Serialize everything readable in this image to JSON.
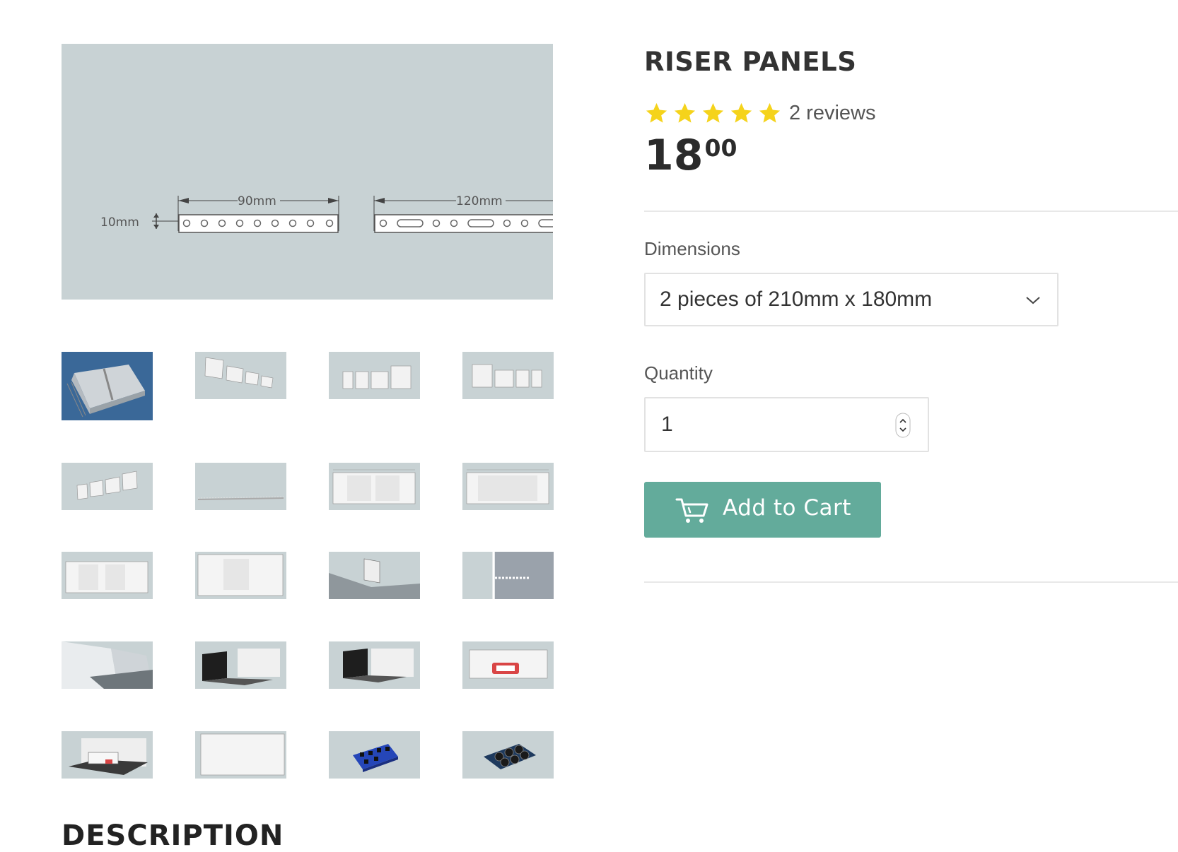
{
  "product": {
    "title": "RISER PANELS",
    "rating": {
      "stars": 5,
      "reviews_text": "2 reviews"
    },
    "price": {
      "main": "18",
      "cents": "00"
    }
  },
  "main_image": {
    "labels": {
      "height": "10mm",
      "width_small": "90mm",
      "width_large": "120mm"
    }
  },
  "options": {
    "dimensions_label": "Dimensions",
    "dimensions_value": "2 pieces of 210mm x 180mm",
    "quantity_label": "Quantity",
    "quantity_value": "1"
  },
  "cart": {
    "button_label": "Add to Cart"
  },
  "description": {
    "heading": "DESCRIPTION"
  },
  "colors": {
    "accent": "#63ab9b",
    "star": "#f5d31b",
    "image_bg": "#c8d2d4"
  },
  "icons": [
    "star-icon",
    "chevron-down-icon",
    "stepper-icon",
    "cart-icon"
  ]
}
